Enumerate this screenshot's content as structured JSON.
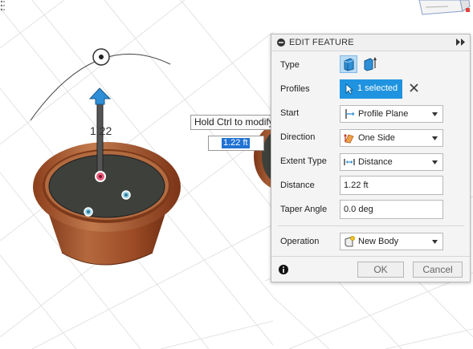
{
  "panel": {
    "title": "EDIT FEATURE",
    "rows": {
      "type": {
        "label": "Type"
      },
      "profiles": {
        "label": "Profiles",
        "selected": "1 selected"
      },
      "start": {
        "label": "Start",
        "value": "Profile Plane"
      },
      "direction": {
        "label": "Direction",
        "value": "One Side"
      },
      "extent_type": {
        "label": "Extent Type",
        "value": "Distance"
      },
      "distance": {
        "label": "Distance",
        "value": "1.22 ft"
      },
      "taper_angle": {
        "label": "Taper Angle",
        "value": "0.0 deg"
      },
      "operation": {
        "label": "Operation",
        "value": "New Body"
      }
    },
    "ok_label": "OK",
    "cancel_label": "Cancel"
  },
  "viewport": {
    "tooltip": "Hold Ctrl to modify selection",
    "distance_input": "1.22 ft",
    "dimension_label": "1.22"
  },
  "colors": {
    "accent": "#1f93df",
    "pot_rim": "#9a4a26",
    "pot_soil": "#3e403c"
  }
}
